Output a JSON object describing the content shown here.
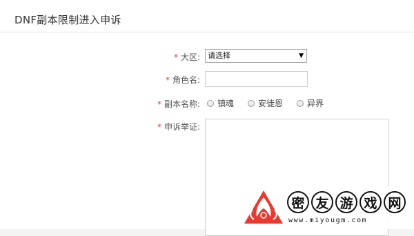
{
  "header": {
    "title": "DNF副本限制进入申诉"
  },
  "form": {
    "required_mark": "*",
    "region": {
      "label": "大区:",
      "selected": "请选择"
    },
    "role_name": {
      "label": "角色名:",
      "value": ""
    },
    "dungeon": {
      "label": "副本名称:",
      "options": [
        "镇魂",
        "安徒恩",
        "异界"
      ]
    },
    "evidence": {
      "label": "申诉举证:",
      "value": ""
    }
  },
  "watermark": {
    "chars": [
      "密",
      "友",
      "游",
      "戏",
      "网"
    ],
    "url": "www.miyougm.com",
    "brand_color": "#e83a2f"
  }
}
